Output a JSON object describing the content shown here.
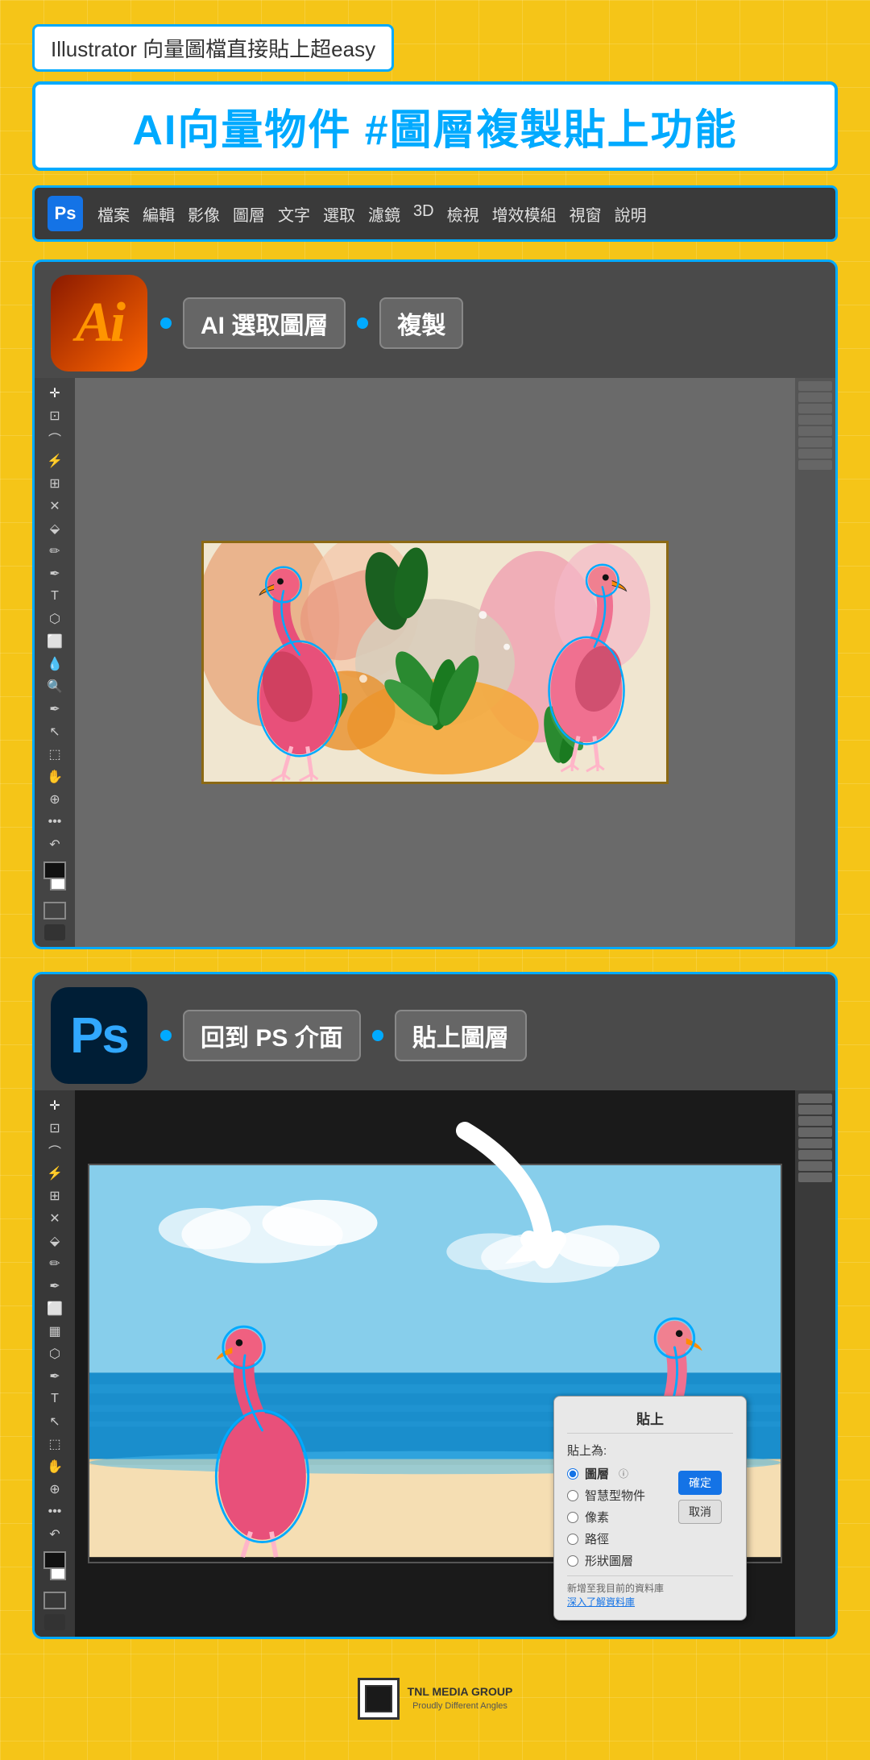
{
  "page": {
    "subtitle": "Illustrator 向量圖檔直接貼上超easy",
    "main_title": "AI向量物件 #圖層複製貼上功能",
    "bg_color": "#F5C518"
  },
  "ps_menubar": {
    "badge_text": "Ps",
    "menu_items": [
      "檔案",
      "編輯",
      "影像",
      "圖層",
      "文字",
      "選取",
      "濾鏡",
      "3D",
      "檢視",
      "增效模組",
      "視窗",
      "說明"
    ]
  },
  "ai_section": {
    "app_icon_text": "Ai",
    "label1": "AI 選取圖層",
    "label2": "複製",
    "dot1": true,
    "dot2": true
  },
  "ps_section": {
    "app_icon_text": "Ps",
    "label1": "回到 PS 介面",
    "label2": "貼上圖層",
    "dot1": true,
    "dot2": true
  },
  "paste_dialog": {
    "title": "貼上",
    "paste_as_label": "貼上為:",
    "options": [
      {
        "id": "opt1",
        "label": "圖層",
        "selected": true
      },
      {
        "id": "opt2",
        "label": "智慧型物件",
        "selected": false
      },
      {
        "id": "opt3",
        "label": "像素",
        "selected": false
      },
      {
        "id": "opt4",
        "label": "路徑",
        "selected": false
      },
      {
        "id": "opt5",
        "label": "形狀圖層",
        "selected": false
      }
    ],
    "confirm_btn": "確定",
    "cancel_btn": "取消",
    "footer_text": "新增至我目前的資料庫",
    "footer_link": "深入了解資料庫"
  },
  "footer": {
    "company": "TNL MEDIA GROUP",
    "tagline": "Proudly Different Angles"
  },
  "tools": [
    "✛",
    "⬚",
    "⬚",
    "✦",
    "⬡",
    "🔍",
    "✏",
    "✒",
    "🖊",
    "⬚",
    "✂",
    "⬡",
    "⭕",
    "💧",
    "🔍",
    "✒",
    "T",
    "↖",
    "⬚",
    "✋",
    "🔍",
    "•••",
    "⬚",
    "↶",
    "⬛"
  ]
}
